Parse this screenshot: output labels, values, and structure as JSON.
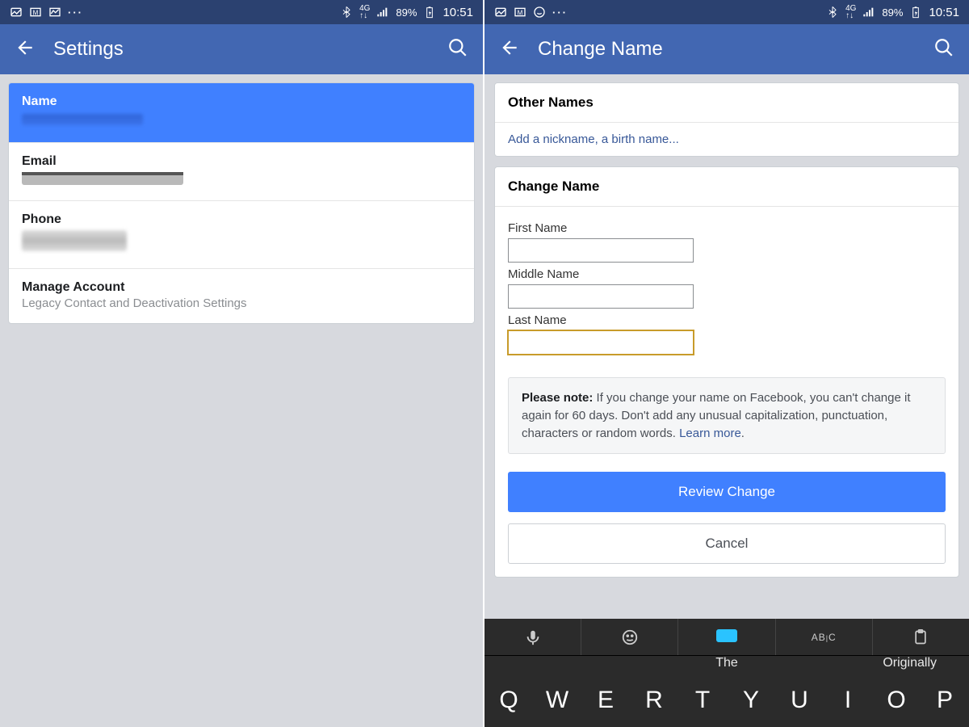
{
  "status": {
    "network_label": "4G",
    "battery": "89%",
    "time": "10:51",
    "more": "···"
  },
  "left": {
    "title": "Settings",
    "rows": {
      "name": {
        "label": "Name"
      },
      "email": {
        "label": "Email"
      },
      "phone": {
        "label": "Phone"
      },
      "manage": {
        "label": "Manage Account",
        "sub": "Legacy Contact and Deactivation Settings"
      }
    }
  },
  "right": {
    "title": "Change Name",
    "other_names": {
      "header": "Other Names",
      "link": "Add a nickname, a birth name..."
    },
    "change": {
      "header": "Change Name",
      "first_label": "First Name",
      "middle_label": "Middle Name",
      "last_label": "Last Name",
      "first": "",
      "middle": "",
      "last": ""
    },
    "notice": {
      "prefix": "Please note:",
      "body": " If you change your name on Facebook, you can't change it again for 60 days. Don't add any unusual capitalization, punctuation, characters or random words. ",
      "learn": "Learn more",
      "period": "."
    },
    "buttons": {
      "review": "Review Change",
      "cancel": "Cancel"
    }
  },
  "keyboard": {
    "suggestions": {
      "center": "The",
      "right": "Originally"
    },
    "row1": [
      "Q",
      "W",
      "E",
      "R",
      "T",
      "Y",
      "U",
      "I",
      "O",
      "P"
    ]
  }
}
